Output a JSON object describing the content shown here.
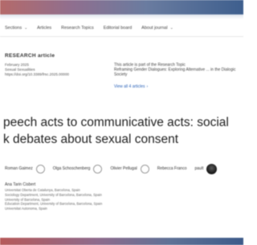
{
  "nav": {
    "items": [
      {
        "label": "Sections",
        "has_dropdown": true
      },
      {
        "label": "Articles",
        "has_dropdown": false
      },
      {
        "label": "Research Topics",
        "has_dropdown": false
      },
      {
        "label": "Editorial board",
        "has_dropdown": false
      },
      {
        "label": "About journal",
        "has_dropdown": true
      }
    ]
  },
  "article": {
    "type": "RESEARCH article",
    "meta": [
      "February 2025",
      "Sexual Sexualities",
      "https://doi.org/10.3389/frsc.2025.00000"
    ],
    "topic_text": "This article is part of the Research Topic",
    "topic_name": "Reframing Gender Dialogues: Exploring Alternative ... in the Dialogic Society",
    "topic_link": "View all 4 articles",
    "title_line1": "peech acts to communicative acts: social",
    "title_line2": "k debates about sexual consent"
  },
  "authors": [
    {
      "name": "Roman Gaimez",
      "badge": "orcid"
    },
    {
      "name": "Olga Schoschenberg",
      "badge": "orcid"
    },
    {
      "name": "Olivier Pellugal",
      "badge": "orcid"
    },
    {
      "name": "Rebecca Franco",
      "badge": "orcid"
    },
    {
      "name": "pault",
      "badge": "none"
    },
    {
      "name": "Ana Tarin Cisbert",
      "badge": "photo"
    }
  ],
  "affiliations": [
    "Universitat Oberta de Catalunya, Barcelona, Spain",
    "Sociology Department, University of Barcelona, Barcelona, Spain",
    "University of Barcelona, Spain",
    "Education Department, University of Barcelona, Barcelona, Spain",
    "Universitat Autonoma, Spain"
  ]
}
